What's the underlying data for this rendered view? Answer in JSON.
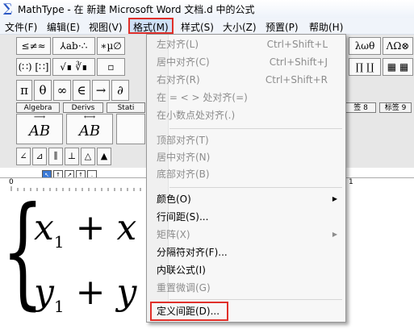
{
  "window": {
    "title": "MathType - 在 新建 Microsoft Word 文档.d 中的公式"
  },
  "menubar": {
    "items": [
      {
        "label": "文件(F)"
      },
      {
        "label": "编辑(E)"
      },
      {
        "label": "视图(V)"
      },
      {
        "label": "格式(M)"
      },
      {
        "label": "样式(S)"
      },
      {
        "label": "大小(Z)"
      },
      {
        "label": "预置(P)"
      },
      {
        "label": "帮助(H)"
      }
    ]
  },
  "toolbar": {
    "row1": [
      "≤≠≈",
      "⅄ab⋅∴",
      "∗µ∅",
      "±•⊗",
      "→⇔↓",
      "∴∀∃",
      "∉∩⊂",
      "∂∞ℓ",
      "λωθ",
      "ΛΩ⊗"
    ],
    "row2": [
      "(∷) [∷]",
      "√∎ ∛∎",
      "▫",
      "Σ∎ Σ∎",
      "∫∎ ∮∎",
      "▭ ▭",
      "→ ←",
      "Ū Ů",
      "∏ ∐",
      "▦ ▦"
    ],
    "row3": [
      "π",
      "θ",
      "∞",
      "∈",
      "→",
      "∂"
    ],
    "tabs": [
      "Algebra",
      "Derivs",
      "Stati"
    ],
    "tabs_right": [
      "签 8",
      "标签 9"
    ],
    "templates": [
      "AB",
      "AB"
    ]
  },
  "format_menu": {
    "items": [
      {
        "label": "左对齐(L)",
        "shortcut": "Ctrl+Shift+L",
        "enabled": false
      },
      {
        "label": "居中对齐(C)",
        "shortcut": "Ctrl+Shift+J",
        "enabled": false
      },
      {
        "label": "右对齐(R)",
        "shortcut": "Ctrl+Shift+R",
        "enabled": false
      },
      {
        "label": "在 = < > 处对齐(=)",
        "shortcut": "",
        "enabled": false
      },
      {
        "label": "在小数点处对齐(.)",
        "shortcut": "",
        "enabled": false
      },
      {
        "label": "顶部对齐(T)",
        "shortcut": "",
        "enabled": false
      },
      {
        "label": "居中对齐(N)",
        "shortcut": "",
        "enabled": false
      },
      {
        "label": "底部对齐(B)",
        "shortcut": "",
        "enabled": false
      },
      {
        "label": "颜色(O)",
        "shortcut": "",
        "enabled": true,
        "submenu": true
      },
      {
        "label": "行间距(S)...",
        "shortcut": "",
        "enabled": true
      },
      {
        "label": "矩阵(X)",
        "shortcut": "",
        "enabled": false,
        "submenu": true
      },
      {
        "label": "分隔符对齐(F)...",
        "shortcut": "",
        "enabled": true
      },
      {
        "label": "内联公式(I)",
        "shortcut": "",
        "enabled": true
      },
      {
        "label": "重置微调(G)",
        "shortcut": "",
        "enabled": false
      },
      {
        "label": "定义间距(D)...",
        "shortcut": "",
        "enabled": true
      }
    ]
  },
  "equation": {
    "line1": {
      "var": "x",
      "sub": "1",
      "op": "+",
      "next": "x"
    },
    "line2": {
      "var": "y",
      "sub": "1",
      "op": "+",
      "next": "y"
    }
  },
  "ruler": {
    "start": "0",
    "mark": "1"
  },
  "colors": {
    "highlight": "#e0302a",
    "menu_bg": "#f7f7f7",
    "active_menu": "#cfe0f6"
  }
}
